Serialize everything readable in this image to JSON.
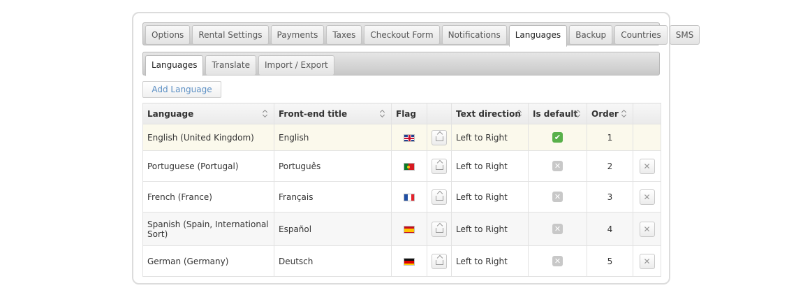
{
  "tabs": [
    {
      "label": "Options"
    },
    {
      "label": "Rental Settings"
    },
    {
      "label": "Payments"
    },
    {
      "label": "Taxes"
    },
    {
      "label": "Checkout Form"
    },
    {
      "label": "Notifications"
    },
    {
      "label": "Languages",
      "active": true
    },
    {
      "label": "Backup"
    },
    {
      "label": "Countries"
    },
    {
      "label": "SMS"
    }
  ],
  "subtabs": [
    {
      "label": "Languages",
      "active": true
    },
    {
      "label": "Translate"
    },
    {
      "label": "Import / Export"
    }
  ],
  "add_button": "Add Language",
  "columns": {
    "language": "Language",
    "title": "Front-end title",
    "flag": "Flag",
    "direction": "Text direction",
    "is_default": "Is default",
    "order": "Order"
  },
  "rows": [
    {
      "language": "English (United Kingdom)",
      "title": "English",
      "flag": "gb",
      "direction": "Left to Right",
      "is_default": true,
      "order": "1"
    },
    {
      "language": "Portuguese (Portugal)",
      "title": "Português",
      "flag": "pt",
      "direction": "Left to Right",
      "is_default": false,
      "order": "2"
    },
    {
      "language": "French (France)",
      "title": "Français",
      "flag": "fr",
      "direction": "Left to Right",
      "is_default": false,
      "order": "3"
    },
    {
      "language": "Spanish (Spain, International Sort)",
      "title": "Español",
      "flag": "es",
      "direction": "Left to Right",
      "is_default": false,
      "order": "4"
    },
    {
      "language": "German (Germany)",
      "title": "Deutsch",
      "flag": "de",
      "direction": "Left to Right",
      "is_default": false,
      "order": "5"
    }
  ],
  "colors": {
    "default_check": "#58b04a",
    "link": "#5b8fc4"
  }
}
